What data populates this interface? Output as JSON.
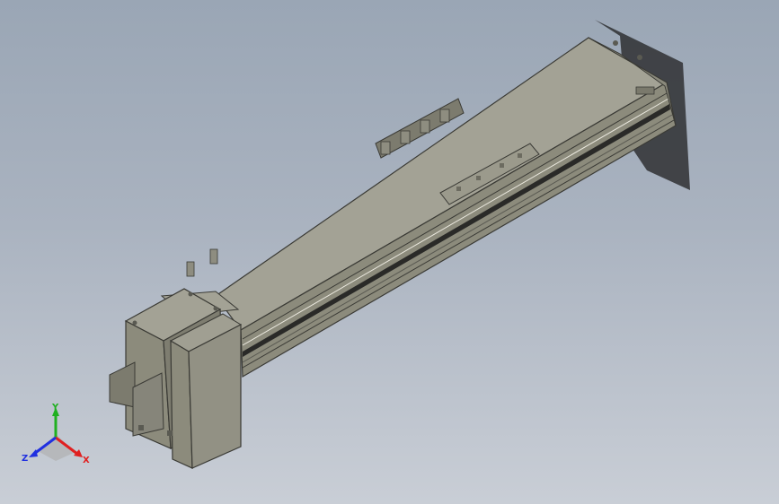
{
  "viewport": {
    "background_top": "#9aa6b5",
    "background_bottom": "#c9ced6"
  },
  "model": {
    "body_color": "#8c8b7c",
    "top_color": "#a3a295",
    "rail_color": "#5a5a52",
    "slot_color": "#2a2a28",
    "edge_color": "#3a3a35"
  },
  "triad": {
    "x_label": "X",
    "y_label": "Y",
    "z_label": "Z",
    "x_color": "#e02020",
    "y_color": "#20b020",
    "z_color": "#2030e0"
  }
}
